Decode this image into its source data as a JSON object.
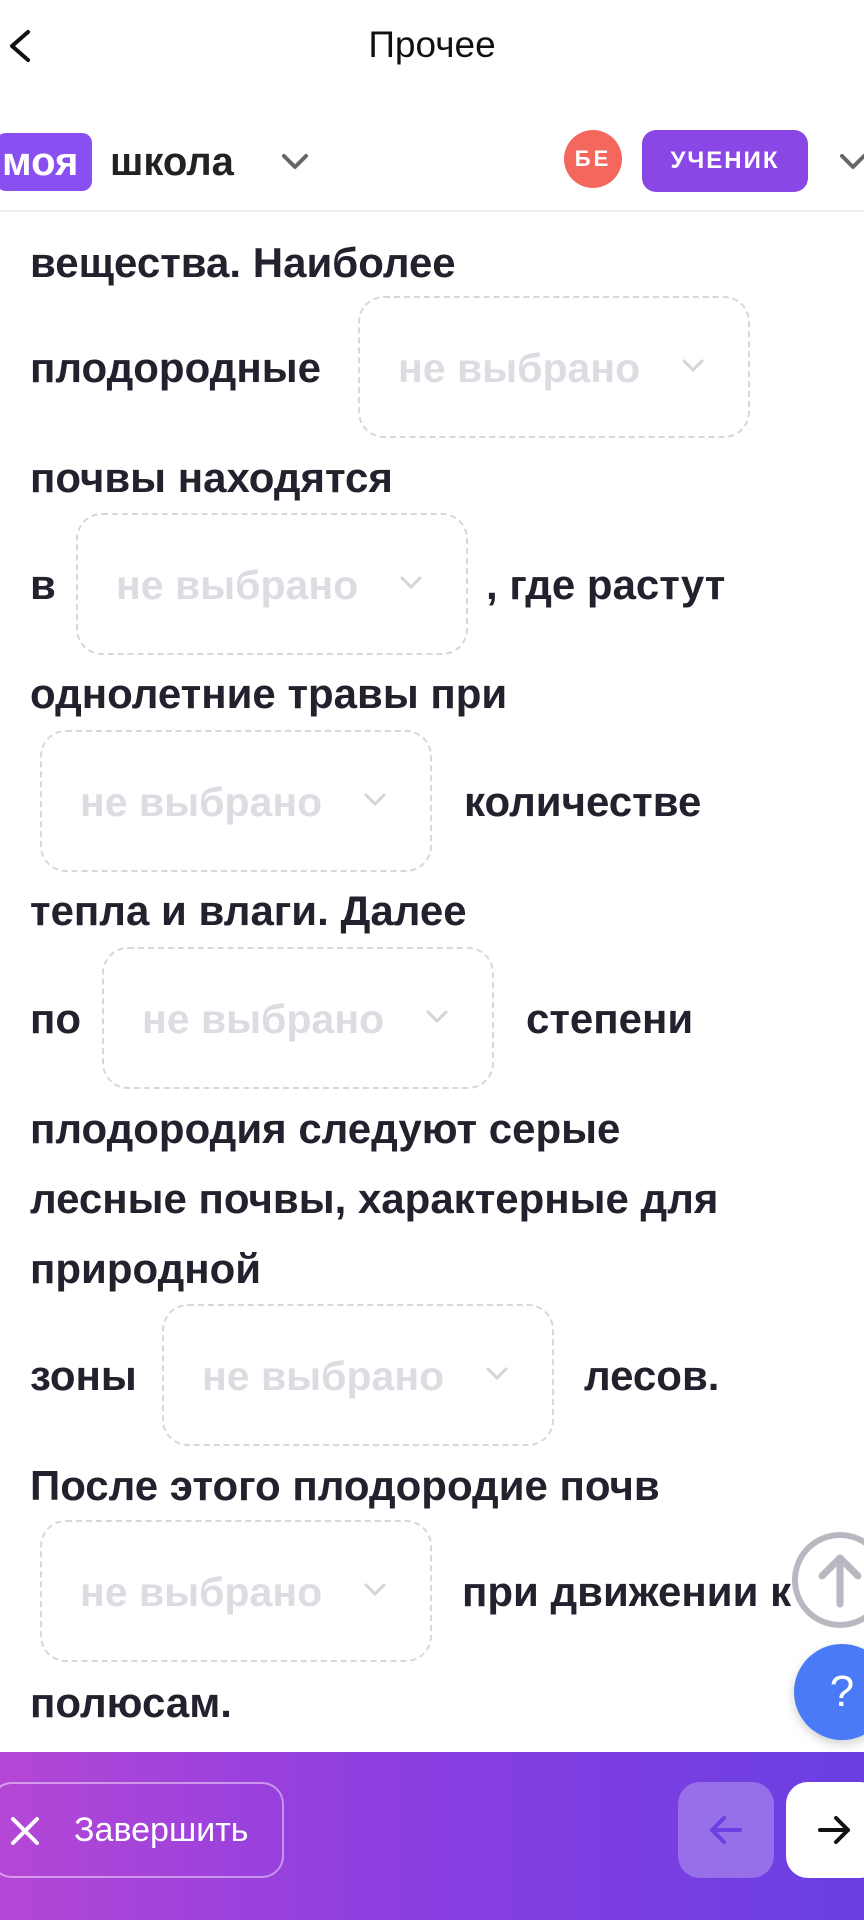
{
  "header": {
    "title": "Прочее"
  },
  "brand": {
    "logo_part1": "моя",
    "logo_part2": "школа",
    "avatar_initials": "БЕ",
    "role": "УЧЕНИК"
  },
  "exercise": {
    "lines": [
      "вещества. Наиболее",
      "плодородные",
      "почвы находятся",
      "в",
      ", где растут",
      "однолетние травы при",
      "количестве",
      "тепла и влаги. Далее",
      "по",
      "степени",
      "плодородия следуют серые",
      "лесные почвы, характерные для",
      "природной",
      "зоны",
      "лесов.",
      "После этого плодородие почв",
      "при движении к",
      "полюсам."
    ],
    "dropdown_placeholder": "не выбрано",
    "dropdown_count": 6
  },
  "floating": {
    "help_label": "?"
  },
  "footer": {
    "finish_label": "Завершить"
  },
  "colors": {
    "accent": "#8a47e6",
    "avatar": "#f4675d",
    "help": "#4a7af5",
    "placeholder": "#dcdce2"
  },
  "icons": [
    "back-chevron-icon",
    "chevron-down-icon",
    "arrow-up-icon",
    "close-icon",
    "arrow-left-icon",
    "arrow-right-icon"
  ]
}
